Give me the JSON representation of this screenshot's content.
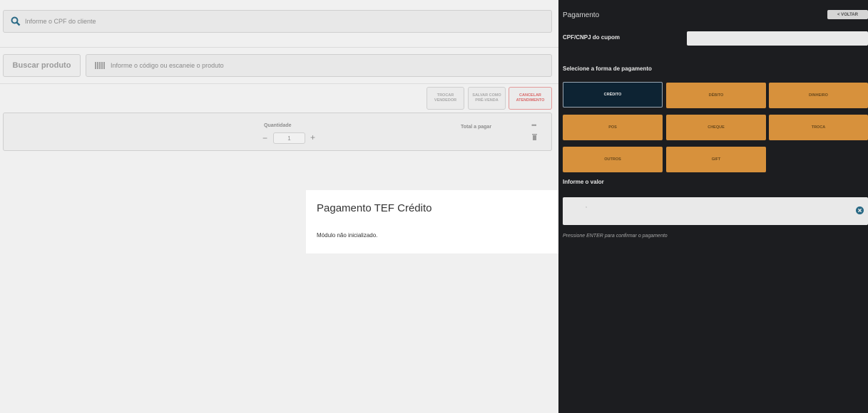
{
  "left": {
    "cpf_placeholder": "Informe o CPF do cliente",
    "buscar_label": "Buscar produto",
    "product_placeholder": "Informe o código ou escaneie o produto",
    "actions": {
      "trocar": "TROCAR\nVENDEDOR",
      "salvar": "SALVAR COMO\nPRÉ-VENDA",
      "cancelar": "CANCELAR\nATENDIMENTO"
    },
    "item": {
      "quantity_label": "Quantidade",
      "quantity_value": "1",
      "minus": "−",
      "plus": "+",
      "total_label": "Total a pagar",
      "more": "•••"
    }
  },
  "modal": {
    "title": "Pagamento TEF Crédito",
    "message": "Módulo não inicializado."
  },
  "payment": {
    "title": "Pagamento",
    "back_label": "< VOLTAR",
    "cpf_label": "CPF/CNPJ do cupom",
    "select_label": "Selecione a forma de pagamento",
    "methods": [
      "CRÉDITO",
      "DÉBITO",
      "DINHEIRO",
      "POS",
      "CHEQUE",
      "TROCA",
      "OUTROS",
      "GIFT"
    ],
    "active_method": "CRÉDITO",
    "value_label": "Informe o valor",
    "value": ",",
    "hint": "Pressione ENTER para confirmar o pagamento"
  },
  "colors": {
    "panel_bg": "#1c1d20",
    "method_orange": "#d7913c",
    "method_active": "#0d2333",
    "cancel_red": "#d96a6a"
  }
}
